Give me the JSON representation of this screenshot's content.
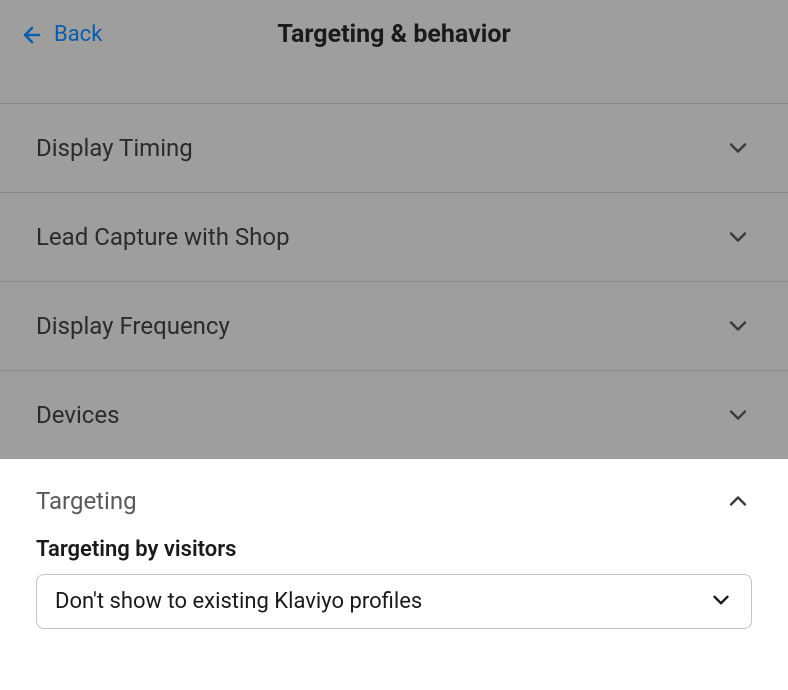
{
  "header": {
    "back_label": "Back",
    "title": "Targeting & behavior"
  },
  "accordion": {
    "items": [
      {
        "label": "Display Timing"
      },
      {
        "label": "Lead Capture with Shop"
      },
      {
        "label": "Display Frequency"
      },
      {
        "label": "Devices"
      }
    ],
    "active": {
      "label": "Targeting"
    }
  },
  "targeting": {
    "field_label": "Targeting by visitors",
    "select_value": "Don't show to existing Klaviyo profiles"
  }
}
